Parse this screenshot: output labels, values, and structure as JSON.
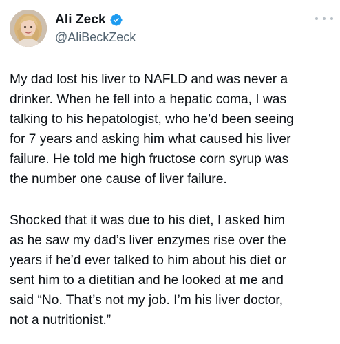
{
  "author": {
    "display_name": "Ali Zeck",
    "handle": "@AliBeckZeck",
    "verified": true,
    "verified_color": "#1d9bf0",
    "avatar_icon": "profile-photo"
  },
  "menu": {
    "icon": "more-options-icon"
  },
  "tweet": {
    "paragraphs": [
      "My dad lost his liver to NAFLD and was never a\ndrinker. When he fell into a hepatic coma, I was\ntalking to his hepatologist, who he’d been seeing\nfor 7 years and asking him what caused his liver\nfailure. He told me high fructose corn syrup was\nthe number one cause of liver failure.",
      "Shocked that it was due to his diet, I asked him\nas he saw my dad’s liver enzymes rise over the\nyears if he’d ever talked to him about his diet or\nsent him to a dietitian and he looked at me and\nsaid “No. That’s not my job. I’m his liver doctor,\nnot a nutritionist.”"
    ]
  }
}
